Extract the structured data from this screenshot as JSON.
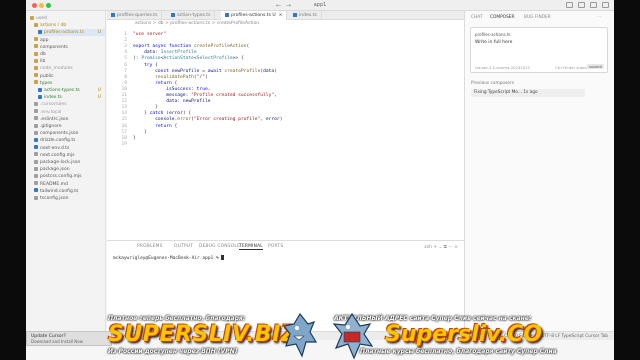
{
  "window": {
    "title": "app1"
  },
  "sidebar": {
    "items": [
      {
        "label": "used",
        "indent": 0,
        "color": "#888",
        "icon": "folder-icon"
      },
      {
        "label": "actions / db",
        "indent": 1,
        "color": "#b8860b",
        "icon": "folder-icon",
        "badge": ""
      },
      {
        "label": "profiles-actions.ts",
        "indent": 2,
        "color": "#b8860b",
        "icon": "ts-file-icon",
        "badge": "U",
        "selected": true
      },
      {
        "label": "app",
        "indent": 1,
        "color": "#555",
        "icon": "folder-icon"
      },
      {
        "label": "components",
        "indent": 1,
        "color": "#555",
        "icon": "folder-icon"
      },
      {
        "label": "db",
        "indent": 1,
        "color": "#555",
        "icon": "folder-icon"
      },
      {
        "label": "lib",
        "indent": 1,
        "color": "#555",
        "icon": "folder-icon"
      },
      {
        "label": "node_modules",
        "indent": 1,
        "color": "#999",
        "icon": "folder-icon"
      },
      {
        "label": "public",
        "indent": 1,
        "color": "#555",
        "icon": "folder-icon"
      },
      {
        "label": "types",
        "indent": 1,
        "color": "#2e7d32",
        "icon": "folder-icon"
      },
      {
        "label": "actions-types.ts",
        "indent": 2,
        "color": "#2e7d32",
        "icon": "ts-file-icon",
        "badge": "U"
      },
      {
        "label": "index.ts",
        "indent": 2,
        "color": "#2e7d32",
        "icon": "ts-file-icon",
        "badge": "U"
      },
      {
        "label": ".cursorrules",
        "indent": 1,
        "color": "#999",
        "icon": "file-icon"
      },
      {
        "label": ".env.local",
        "indent": 1,
        "color": "#999",
        "icon": "file-icon"
      },
      {
        "label": ".eslintrc.json",
        "indent": 1,
        "color": "#555",
        "icon": "json-icon"
      },
      {
        "label": ".gitignore",
        "indent": 1,
        "color": "#555",
        "icon": "git-icon"
      },
      {
        "label": "components.json",
        "indent": 1,
        "color": "#555",
        "icon": "json-icon"
      },
      {
        "label": "drizzle.config.ts",
        "indent": 1,
        "color": "#555",
        "icon": "ts-file-icon"
      },
      {
        "label": "next-env.d.ts",
        "indent": 1,
        "color": "#555",
        "icon": "ts-file-icon"
      },
      {
        "label": "next.config.mjs",
        "indent": 1,
        "color": "#555",
        "icon": "js-file-icon"
      },
      {
        "label": "package-lock.json",
        "indent": 1,
        "color": "#555",
        "icon": "json-icon"
      },
      {
        "label": "package.json",
        "indent": 1,
        "color": "#555",
        "icon": "json-icon"
      },
      {
        "label": "postcss.config.mjs",
        "indent": 1,
        "color": "#555",
        "icon": "js-file-icon"
      },
      {
        "label": "README.md",
        "indent": 1,
        "color": "#555",
        "icon": "md-icon"
      },
      {
        "label": "tailwind.config.ts",
        "indent": 1,
        "color": "#555",
        "icon": "ts-file-icon"
      },
      {
        "label": "tsconfig.json",
        "indent": 1,
        "color": "#555",
        "icon": "json-icon"
      }
    ]
  },
  "tabs": [
    {
      "label": "profiles-queries.ts",
      "active": false
    },
    {
      "label": "action-types.ts",
      "active": false
    },
    {
      "label": "profiles-actions.ts U",
      "active": true
    },
    {
      "label": "index.ts",
      "active": false
    }
  ],
  "breadcrumb": "actions > db > profiles-actions.ts > createProfileAction",
  "editor": {
    "lines": [
      {
        "n": "1",
        "html": "<span class='s'>\"use server\"</span>"
      },
      {
        "n": "2",
        "html": ""
      },
      {
        "n": "3",
        "html": "<span class='k'>export async function</span> <span class='f'>createProfileAction</span>("
      },
      {
        "n": "4",
        "html": "    <span class='v'>data</span>: <span class='c'>InsertProfile</span>"
      },
      {
        "n": "5",
        "html": "): <span class='c'>Promise</span>&lt;<span class='c'>ActionState</span>&lt;<span class='c'>SelectProfile</span>&gt;&gt; {"
      },
      {
        "n": "6",
        "html": "    <span class='k'>try</span> {"
      },
      {
        "n": "7",
        "html": "        <span class='k'>const</span> <span class='v'>newProfile</span> = <span class='k'>await</span> <span class='f'>createProfile</span>(<span class='v'>data</span>)"
      },
      {
        "n": "8",
        "html": "        <span class='f'>revalidatePath</span>(<span class='s'>\"/\"</span>)"
      },
      {
        "n": "9",
        "html": "        <span class='k'>return</span> {"
      },
      {
        "n": "10",
        "html": "            <span class='v'>isSuccess</span>: <span class='k'>true</span>,"
      },
      {
        "n": "11",
        "html": "            <span class='v'>message</span>: <span class='s'>\"Profile created successfully\"</span>,"
      },
      {
        "n": "12",
        "html": "            <span class='v'>data</span>: <span class='v'>newProfile</span>"
      },
      {
        "n": "13",
        "html": "        }"
      },
      {
        "n": "14",
        "html": "    } <span class='k'>catch</span> (<span class='v'>error</span>) {"
      },
      {
        "n": "15",
        "html": "        <span class='v'>console</span>.<span class='f'>error</span>(<span class='s'>\"Error creating profile\"</span>, <span class='v'>error</span>)"
      },
      {
        "n": "16",
        "html": "        <span class='k'>return</span> {"
      },
      {
        "n": "17",
        "html": "    }"
      },
      {
        "n": "18",
        "html": "}"
      },
      {
        "n": "19",
        "html": ""
      }
    ],
    "codelens": "Ctrl+L to chat, Ctrl+K to generate"
  },
  "panel": {
    "tabs": [
      "PROBLEMS",
      "OUTPUT",
      "DEBUG CONSOLE",
      "TERMINAL",
      "PORTS"
    ],
    "active_tab": "TERMINAL",
    "terminal_line": "mckaywrigley@Eugenes-MacBook-Air app1 %",
    "tools": "zsh  +  ⌄  ⧉  ⋯  ×"
  },
  "right_pane": {
    "tabs": [
      "CHAT",
      "COMPOSER",
      "BUG FINDER"
    ],
    "active_tab": "COMPOSER",
    "composer_chip": "profiles-actions.ts",
    "composer_text": "Write in full here",
    "composer_meta": "claude-3.5-sonnet-20241022",
    "composer_meta2": "Ctrl+Enter  submit",
    "composer_send": "submit",
    "previous_title": "Previous composers",
    "previous_item": "Fixing TypeScript Mo...  1s ago"
  },
  "statusbar": {
    "left": "⎇ main*  ⊙  0 ⚠ 0",
    "right": "Ln 14, Col 10   Spaces: 2   UTF-8   LF   TypeScript   Cursor Tab"
  },
  "toast": {
    "line1": "Update Cursor?",
    "line2": "Download and Install Now"
  },
  "watermark": {
    "top": "Платное теперь бесплатно, благодаря:",
    "logo_left": "SUPERSLIV.BIZ",
    "bottom_left": "Из России доступен через ВПН (VPN)",
    "top_right": "АКТУАЛЬНЫЙ АДРЕС сайта Супер Слив сейчас на скане:",
    "logo_right": "Supersliv.CO",
    "bottom_right": "Платные курсы бесплатно, благодаря сайту Супер Слив"
  },
  "colors": {
    "accent": "#3178c6",
    "badge": "#b8860b",
    "watermark_gold": "#f6c700"
  }
}
